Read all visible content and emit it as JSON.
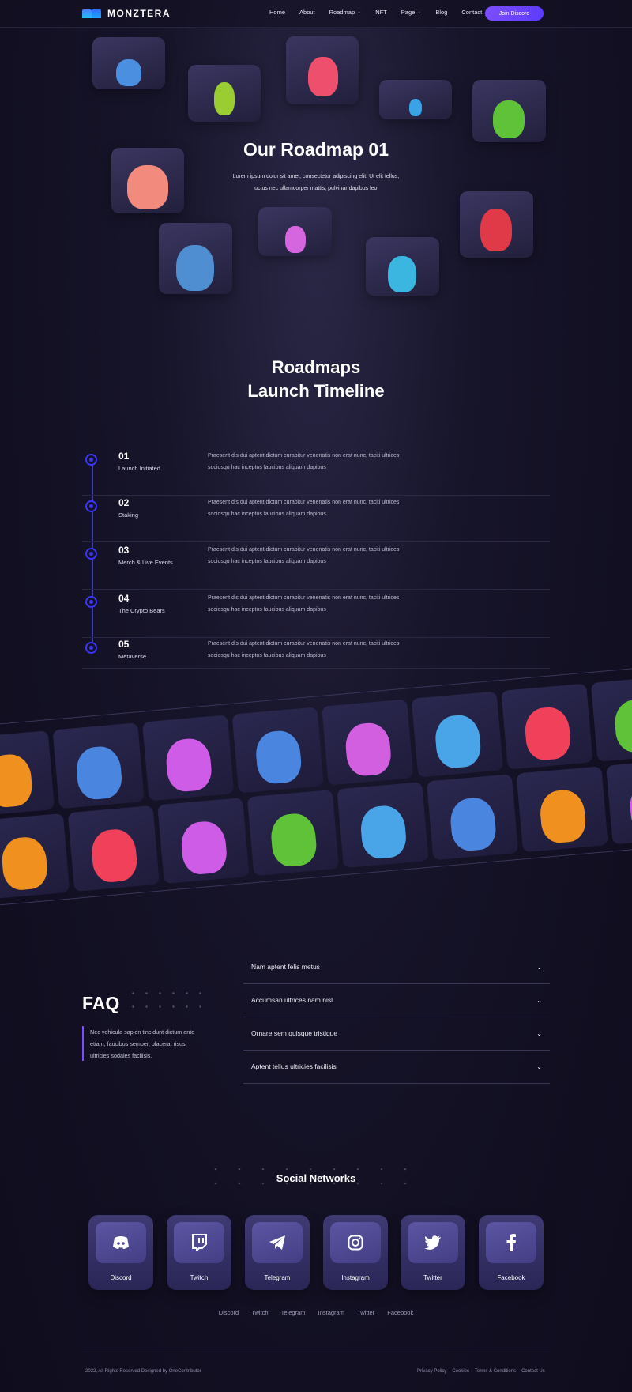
{
  "brand": {
    "name": "MONZTERA"
  },
  "nav": {
    "items": [
      {
        "label": "Home",
        "dropdown": false
      },
      {
        "label": "About",
        "dropdown": false
      },
      {
        "label": "Roadmap",
        "dropdown": true
      },
      {
        "label": "NFT",
        "dropdown": false
      },
      {
        "label": "Page",
        "dropdown": true
      },
      {
        "label": "Blog",
        "dropdown": false
      },
      {
        "label": "Contact",
        "dropdown": false
      }
    ],
    "cta": "Join Discord"
  },
  "hero": {
    "title": "Our Roadmap 01",
    "subtitle": "Lorem ipsum dolor sit amet, consectetur adipiscing elit. Ut elit tellus, luctus nec ullamcorper mattis, pulvinar dapibus leo."
  },
  "roadmap": {
    "title_line1": "Roadmaps",
    "title_line2": "Launch Timeline",
    "items": [
      {
        "num": "01",
        "label": "Launch Initiated",
        "desc": "Praesent dis dui aptent dictum curabitur venenatis non erat nunc, taciti ultrices sociosqu hac inceptos faucibus aliquam dapibus"
      },
      {
        "num": "02",
        "label": "Staking",
        "desc": "Praesent dis dui aptent dictum curabitur venenatis non erat nunc, taciti ultrices sociosqu hac inceptos faucibus aliquam dapibus"
      },
      {
        "num": "03",
        "label": "Merch & Live Events",
        "desc": "Praesent dis dui aptent dictum curabitur venenatis non erat nunc, taciti ultrices sociosqu hac inceptos faucibus aliquam dapibus"
      },
      {
        "num": "04",
        "label": "The Crypto Bears",
        "desc": "Praesent dis dui aptent dictum curabitur venenatis non erat nunc, taciti ultrices sociosqu hac inceptos faucibus aliquam dapibus"
      },
      {
        "num": "05",
        "label": "Metaverse",
        "desc": "Praesent dis dui aptent dictum curabitur venenatis non erat nunc, taciti ultrices sociosqu hac inceptos faucibus aliquam dapibus"
      }
    ]
  },
  "faq": {
    "title": "FAQ",
    "description": "Nec vehicula sapien tincidunt dictum ante etiam, faucibus semper, placerat risus ultricies sodales facilisis.",
    "questions": [
      "Nam aptent felis metus",
      "Accumsan ultrices nam nisl",
      "Ornare sem quisque tristique",
      "Aptent tellus ultricies facilisis"
    ]
  },
  "social": {
    "title": "Social Networks",
    "cards": [
      {
        "label": "Discord",
        "icon": "discord-icon"
      },
      {
        "label": "Twitch",
        "icon": "twitch-icon"
      },
      {
        "label": "Telegram",
        "icon": "telegram-icon"
      },
      {
        "label": "Instagram",
        "icon": "instagram-icon"
      },
      {
        "label": "Twitter",
        "icon": "twitter-icon"
      },
      {
        "label": "Facebook",
        "icon": "facebook-icon"
      }
    ],
    "links": [
      "Discord",
      "Twitch",
      "Telegram",
      "Instagram",
      "Twitter",
      "Facebook"
    ]
  },
  "footer": {
    "copyright": "2022, All Rights Reserved Designed by OneContributor",
    "legal": [
      "Privacy Policy",
      "Cookies",
      "Terms & Conditions",
      "Contact Us"
    ]
  },
  "colors": {
    "accent": "#6a44ff",
    "background": "#141226",
    "timeline": "#3b35ff"
  }
}
